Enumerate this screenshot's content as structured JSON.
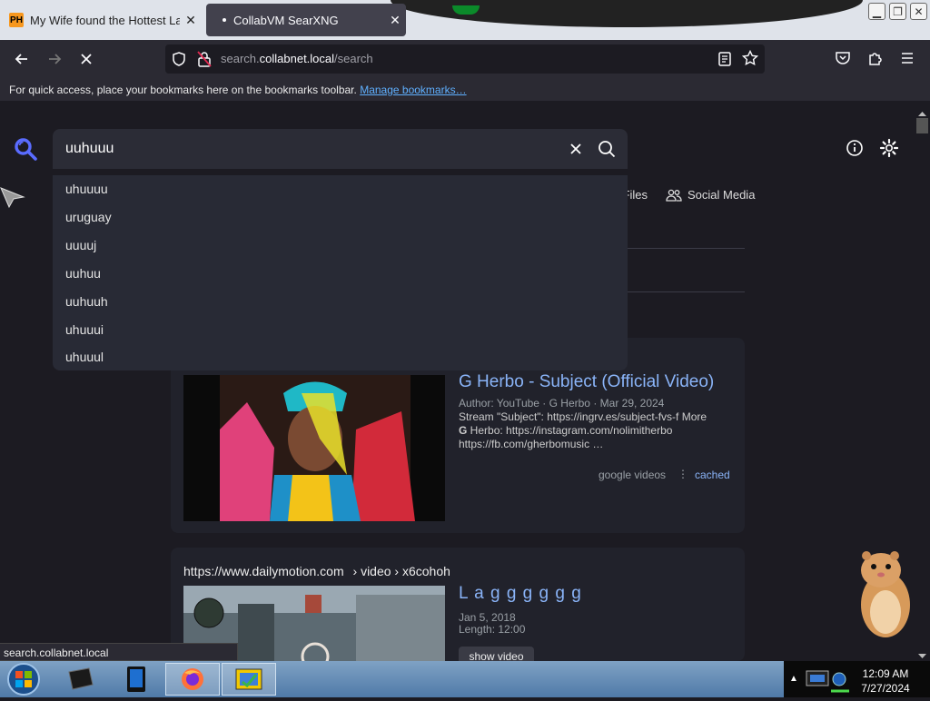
{
  "tabs": [
    {
      "label": "My Wife found the Hottest Lati",
      "favicon": "PH"
    },
    {
      "label": "CollabVM SearXNG"
    }
  ],
  "url": {
    "prefix": "search.",
    "host": "collabnet.local",
    "path": "/search"
  },
  "bookmarks_bar": {
    "text": "For quick access, place your bookmarks here on the bookmarks toolbar.",
    "link": "Manage bookmarks…"
  },
  "search": {
    "query": "uuhuuu"
  },
  "suggestions": [
    "uhuuuu",
    "uruguay",
    "uuuuj",
    "uuhuu",
    "uuhuuh",
    "uhuuui",
    "uhuuul"
  ],
  "filters": {
    "files": "Files",
    "social": "Social Media"
  },
  "results": [
    {
      "title": "G Herbo - Subject (Official Video)",
      "meta": "Author: YouTube · G Herbo · Mar 29, 2024",
      "snippet_1": "Stream \"Subject\": https://ingrv.es/subject-fvs-f More",
      "snippet_2_bold": "G",
      "snippet_2": " Herbo: https://instagram.com/nolimitherbo",
      "snippet_3": "https://fb.com/gherbomusic …",
      "engine": "google videos",
      "cached": "cached"
    },
    {
      "url": "https://www.dailymotion.com",
      "breadcrumb": "› video › x6cohoh",
      "title": "L a g g g g g g",
      "date": "Jan 5, 2018",
      "length": "Length: 12:00",
      "button": "show video"
    }
  ],
  "status_url": "search.collabnet.local",
  "clock": {
    "time": "12:09 AM",
    "date": "7/27/2024"
  },
  "colors": {
    "accent": "#8ab4f8",
    "search_icon": "#5a6cff",
    "link": "#5fb0ff"
  }
}
